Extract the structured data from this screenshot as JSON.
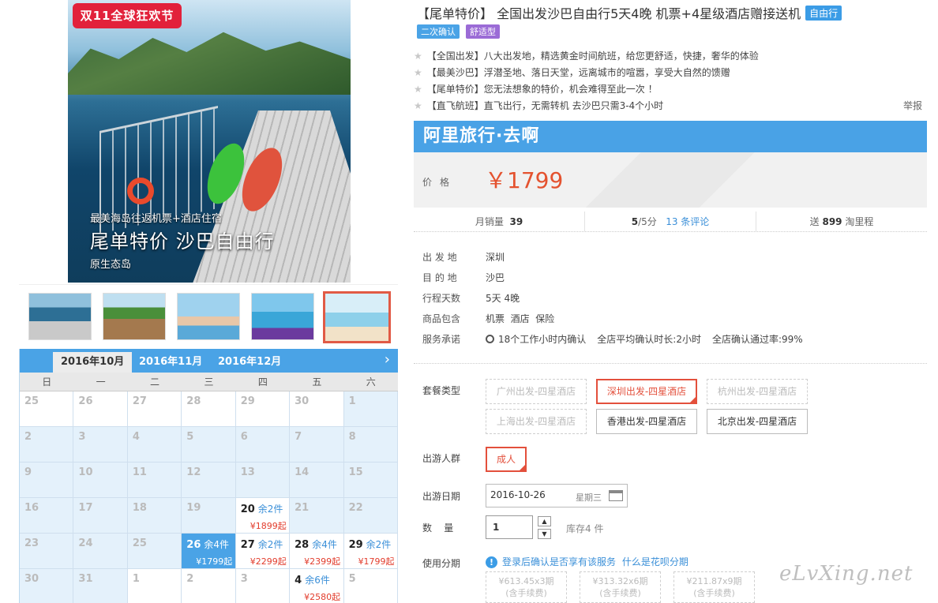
{
  "gallery": {
    "badge": "双11全球狂欢节",
    "caption_small": "最美海岛往返机票+酒店住宿",
    "caption_big": "尾单特价 沙巴自由行",
    "caption_sub": "原生态岛",
    "thumbs_count": 5,
    "active_thumb": 5
  },
  "calendar": {
    "tabs": [
      "2016年10月",
      "2016年11月",
      "2016年12月"
    ],
    "next_icon": "chevron-right-icon",
    "weekdays": [
      "日",
      "一",
      "二",
      "三",
      "四",
      "五",
      "六"
    ],
    "rows": [
      [
        {
          "d": "25",
          "t": "dim"
        },
        {
          "d": "26",
          "t": "dim"
        },
        {
          "d": "27",
          "t": "dim"
        },
        {
          "d": "28",
          "t": "dim"
        },
        {
          "d": "29",
          "t": "dim"
        },
        {
          "d": "30",
          "t": "dim"
        },
        {
          "d": "1",
          "t": "cur"
        }
      ],
      [
        {
          "d": "2",
          "t": "cur"
        },
        {
          "d": "3",
          "t": "cur"
        },
        {
          "d": "4",
          "t": "cur"
        },
        {
          "d": "5",
          "t": "cur"
        },
        {
          "d": "6",
          "t": "cur"
        },
        {
          "d": "7",
          "t": "cur"
        },
        {
          "d": "8",
          "t": "cur"
        }
      ],
      [
        {
          "d": "9",
          "t": "cur"
        },
        {
          "d": "10",
          "t": "cur"
        },
        {
          "d": "11",
          "t": "cur"
        },
        {
          "d": "12",
          "t": "cur"
        },
        {
          "d": "13",
          "t": "cur"
        },
        {
          "d": "14",
          "t": "cur"
        },
        {
          "d": "15",
          "t": "cur"
        }
      ],
      [
        {
          "d": "16",
          "t": "cur"
        },
        {
          "d": "17",
          "t": "cur"
        },
        {
          "d": "18",
          "t": "cur"
        },
        {
          "d": "19",
          "t": "cur"
        },
        {
          "d": "20",
          "t": "avail",
          "rem": "余2件",
          "pr": "¥1899起"
        },
        {
          "d": "21",
          "t": "cur"
        },
        {
          "d": "22",
          "t": "cur"
        }
      ],
      [
        {
          "d": "23",
          "t": "cur"
        },
        {
          "d": "24",
          "t": "cur"
        },
        {
          "d": "25",
          "t": "cur"
        },
        {
          "d": "26",
          "t": "sel",
          "rem": "余4件",
          "pr": "¥1799起"
        },
        {
          "d": "27",
          "t": "avail",
          "rem": "余2件",
          "pr": "¥2299起"
        },
        {
          "d": "28",
          "t": "avail",
          "rem": "余4件",
          "pr": "¥2399起"
        },
        {
          "d": "29",
          "t": "avail",
          "rem": "余2件",
          "pr": "¥1799起"
        }
      ],
      [
        {
          "d": "30",
          "t": "cur"
        },
        {
          "d": "31",
          "t": "cur"
        },
        {
          "d": "1",
          "t": "dim"
        },
        {
          "d": "2",
          "t": "dim"
        },
        {
          "d": "3",
          "t": "dim"
        },
        {
          "d": "4",
          "t": "avail",
          "rem": "余6件",
          "pr": "¥2580起"
        },
        {
          "d": "5",
          "t": "dim"
        }
      ]
    ]
  },
  "product": {
    "title": "【尾单特价】 全国出发沙巴自由行5天4晚 机票+4星级酒店赠接送机",
    "type_tag": "自由行",
    "tags": [
      {
        "label": "二次确认",
        "color": "#4aa3e6"
      },
      {
        "label": "舒适型",
        "color": "#9b6bd6"
      }
    ],
    "features": [
      "【全国出发】八大出发地，精选黄金时间航班，给您更舒适，快捷，奢华的体验",
      "【最美沙巴】浮潜圣地、落日天堂，远离城市的喧嚣，享受大自然的馈赠",
      "【尾单特价】您无法想象的特价，机会难得至此一次 ！",
      "【直飞航班】直飞出行，无需转机 去沙巴只需3-4个小时"
    ],
    "report": "举报",
    "brand": "阿里旅行·去啊",
    "price_label": "价格",
    "price": "￥1799"
  },
  "stats": {
    "sales_label": "月销量",
    "sales": "39",
    "rating": "5",
    "rating_suffix": "/5分",
    "reviews": "13 条评论",
    "miles_prefix": "送",
    "miles": "899",
    "miles_suffix": "淘里程"
  },
  "info": [
    {
      "k": "出 发 地",
      "v": "深圳"
    },
    {
      "k": "目 的 地",
      "v": "沙巴"
    },
    {
      "k": "行程天数",
      "v": "5天 4晚"
    },
    {
      "k": "商品包含",
      "v": "机票  酒店  保险"
    }
  ],
  "service": {
    "k": "服务承诺",
    "v1": "18个工作小时内确认",
    "v2": "全店平均确认时长:2小时",
    "v3": "全店确认通过率:99%"
  },
  "options": {
    "package_label": "套餐类型",
    "packages": [
      {
        "label": "广州出发-四星酒店",
        "state": "dis"
      },
      {
        "label": "深圳出发-四星酒店",
        "state": "on"
      },
      {
        "label": "杭州出发-四星酒店",
        "state": "dis"
      },
      {
        "label": "上海出发-四星酒店",
        "state": "dis"
      },
      {
        "label": "香港出发-四星酒店",
        "state": "normal"
      },
      {
        "label": "北京出发-四星酒店",
        "state": "normal"
      }
    ],
    "people_label": "出游人群",
    "people": "成人",
    "date_label": "出游日期",
    "date_value": "2016-10-26",
    "date_weekday": "星期三",
    "qty_label": "数    量",
    "qty_value": "1",
    "stock": "库存4 件",
    "install_label": "使用分期",
    "install_tip": "登录后确认是否享有该服务",
    "install_link": "什么是花呗分期",
    "installments": [
      {
        "amt": "¥613.45x3期",
        "fee": "(含手续费)"
      },
      {
        "amt": "¥313.32x6期",
        "fee": "(含手续费)"
      },
      {
        "amt": "¥211.87x9期",
        "fee": "(含手续费)"
      }
    ]
  },
  "watermark": "eLvXing.net"
}
